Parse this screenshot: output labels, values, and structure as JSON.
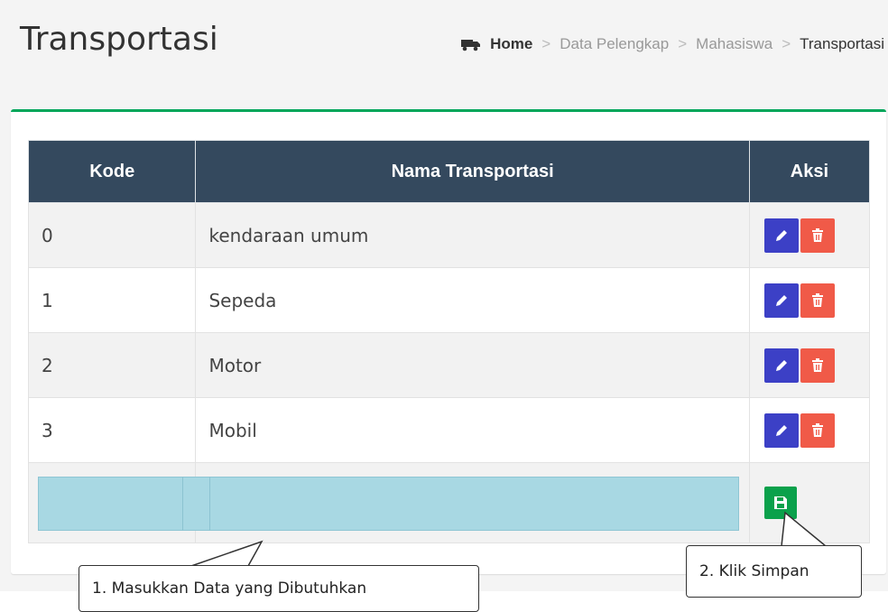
{
  "page": {
    "title": "Transportasi"
  },
  "breadcrumb": {
    "home": "Home",
    "level1": "Data Pelengkap",
    "level2": "Mahasiswa",
    "current": "Transportasi"
  },
  "table": {
    "headers": [
      "Kode",
      "Nama Transportasi",
      "Aksi"
    ],
    "rows": [
      {
        "kode": "0",
        "nama": "kendaraan umum"
      },
      {
        "kode": "1",
        "nama": "Sepeda"
      },
      {
        "kode": "2",
        "nama": "Motor"
      },
      {
        "kode": "3",
        "nama": "Mobil"
      }
    ],
    "new_row": {
      "kode_value": "",
      "nama_value": ""
    }
  },
  "annotations": {
    "step1": "1.  Masukkan Data yang Dibutuhkan",
    "step2": "2.  Klik Simpan"
  },
  "colors": {
    "header_bg": "#34495e",
    "box_accent": "#00a65a",
    "edit": "#3c40c6",
    "delete": "#f05a48",
    "save": "#0aa14b",
    "input_highlight": "#a8d8e3"
  },
  "icons": {
    "breadcrumb": "truck-icon",
    "edit": "pencil-icon",
    "delete": "trash-icon",
    "save": "floppy-disk-icon"
  }
}
